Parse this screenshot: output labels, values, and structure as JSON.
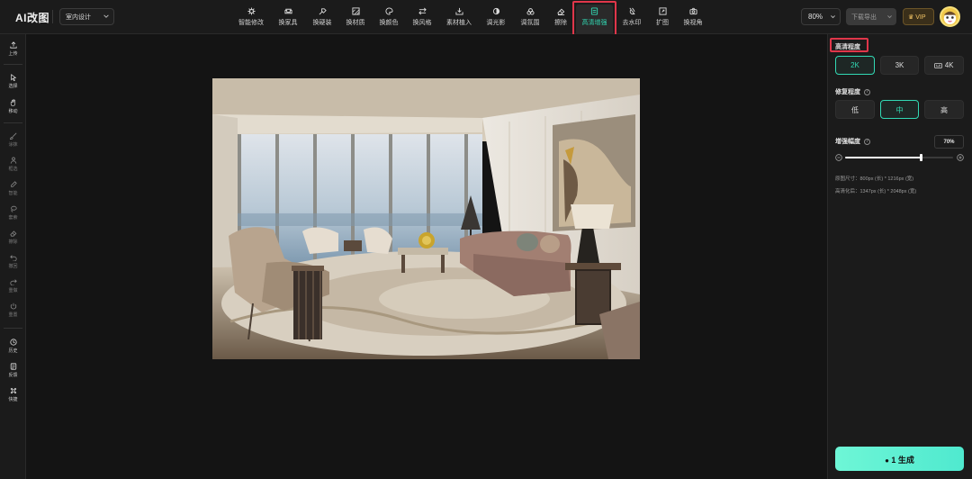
{
  "app": {
    "logo": "AI改图",
    "scene": "室内设计"
  },
  "toolbar": {
    "tools": [
      {
        "label": "智能修改",
        "icon": "gear-icon"
      },
      {
        "label": "换家具",
        "icon": "armchair-icon"
      },
      {
        "label": "换硬装",
        "icon": "hammer-icon"
      },
      {
        "label": "换材质",
        "icon": "texture-icon"
      },
      {
        "label": "换颜色",
        "icon": "palette-icon"
      },
      {
        "label": "换风格",
        "icon": "swap-icon"
      },
      {
        "label": "素材植入",
        "icon": "import-icon"
      },
      {
        "label": "调光影",
        "icon": "light-icon"
      },
      {
        "label": "调氛围",
        "icon": "atmosphere-icon"
      },
      {
        "label": "擦除",
        "icon": "eraser-icon"
      },
      {
        "label": "高清增强",
        "icon": "hd-icon",
        "active": true
      },
      {
        "label": "去水印",
        "icon": "watermark-icon"
      },
      {
        "label": "扩图",
        "icon": "expand-icon"
      },
      {
        "label": "换视角",
        "icon": "camera-icon"
      }
    ],
    "zoom": "80%",
    "export_label": "下载导出",
    "vip_label": "VIP"
  },
  "leftbar": {
    "items": [
      {
        "label": "上传",
        "icon": "upload-icon"
      },
      {
        "label": "选择",
        "icon": "cursor-icon"
      },
      {
        "label": "移动",
        "icon": "hand-icon"
      },
      {
        "label": "涂抹",
        "icon": "brush-icon"
      },
      {
        "label": "框选",
        "icon": "person-select-icon"
      },
      {
        "label": "智能",
        "icon": "pen-icon"
      },
      {
        "label": "套索",
        "icon": "lasso-icon"
      },
      {
        "label": "擦除",
        "icon": "eraser-icon"
      },
      {
        "label": "撤回",
        "icon": "undo-icon"
      },
      {
        "label": "重做",
        "icon": "redo-icon"
      },
      {
        "label": "重置",
        "icon": "reset-icon"
      },
      {
        "label": "历史",
        "icon": "history-icon"
      },
      {
        "label": "反馈",
        "icon": "feedback-icon"
      },
      {
        "label": "快捷",
        "icon": "command-icon"
      }
    ]
  },
  "panel": {
    "clarity_title": "高清程度",
    "clarity_options": [
      "2K",
      "3K",
      "4K"
    ],
    "clarity_selected": "2K",
    "repair_title": "修复程度",
    "repair_options": [
      "低",
      "中",
      "高"
    ],
    "repair_selected": "中",
    "enhance_title": "增强幅度",
    "enhance_value": "70%",
    "enhance_level": 0.7,
    "orig_size": "原图尺寸：800px (长) * 1216px (宽)",
    "hd_size": "高清化后：1347px (长) * 2048px (宽)",
    "generate_label": "1 生成"
  },
  "colors": {
    "accent": "#32d9b4",
    "highlight": "#e0364a",
    "vip": "#f1c365"
  }
}
